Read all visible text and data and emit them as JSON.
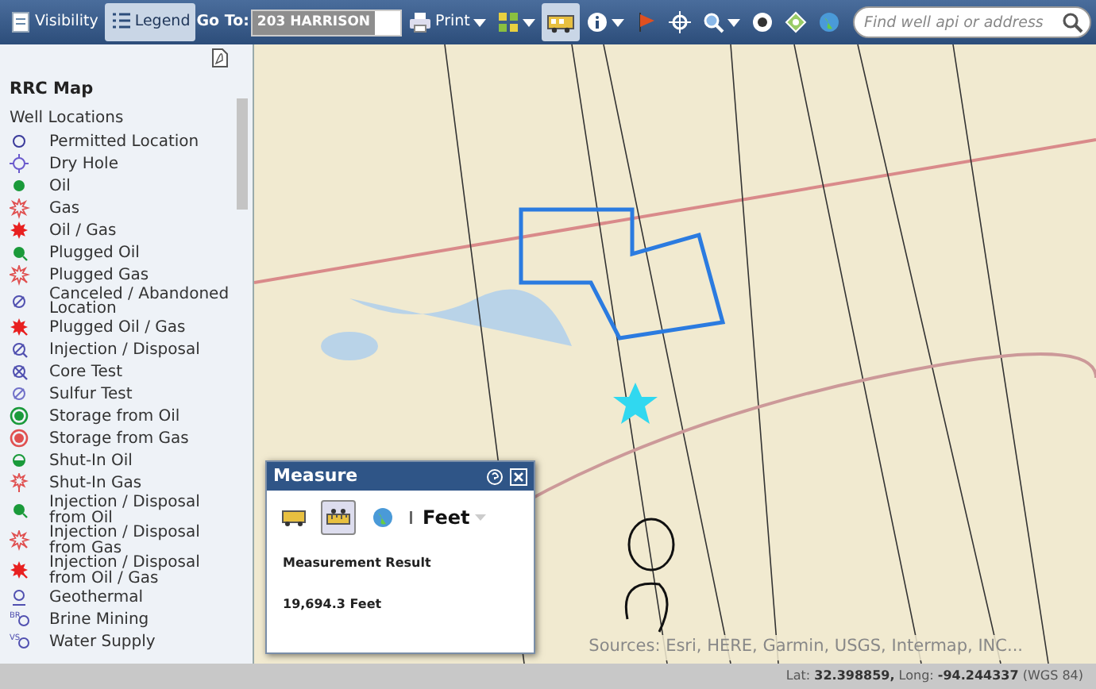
{
  "toolbar": {
    "tools": [
      {
        "kind": "button",
        "label": "Visibility",
        "selected": false
      },
      {
        "kind": "button",
        "label": "Legend",
        "selected": true
      },
      {
        "kind": "label",
        "label": "Go To:"
      },
      {
        "kind": "field",
        "value": "203 HARRISON"
      },
      {
        "kind": "menu",
        "label": "Print",
        "selected": false
      },
      {
        "kind": "menu",
        "selected": false
      },
      {
        "kind": "tool",
        "selected": true
      },
      {
        "kind": "menu",
        "selected": false
      },
      {
        "kind": "tool",
        "selected": false
      },
      {
        "kind": "tool",
        "selected": false
      },
      {
        "kind": "menu",
        "selected": false
      },
      {
        "kind": "tool",
        "selected": false
      },
      {
        "kind": "tool",
        "selected": false
      },
      {
        "kind": "tool",
        "selected": false
      }
    ],
    "search": {
      "placeholder": "Find well api or address"
    }
  },
  "sidebar": {
    "title": "RRC Map",
    "section": "Well Locations",
    "items": [
      {
        "label": "Permitted Location",
        "kind": "ring",
        "color": "#3a3a9a",
        "tailed": false
      },
      {
        "label": "Dry Hole",
        "kind": "target",
        "color": "#6a5acd",
        "tailed": false
      },
      {
        "label": "Oil",
        "kind": "dot",
        "color": "#1a9a3a",
        "tailed": false
      },
      {
        "label": "Gas",
        "kind": "star",
        "color": "#e05050",
        "tailed": false
      },
      {
        "label": "Oil / Gas",
        "kind": "burst",
        "color": "#e82020",
        "tailed": false
      },
      {
        "label": "Plugged Oil",
        "kind": "dot",
        "color": "#1a9a3a",
        "tailed": true
      },
      {
        "label": "Plugged Gas",
        "kind": "star",
        "color": "#e05050",
        "tailed": true
      },
      {
        "label": "Canceled / Abandoned Location",
        "kind": "slashed",
        "color": "#5050b0",
        "tailed": false
      },
      {
        "label": "Plugged Oil / Gas",
        "kind": "burst",
        "color": "#e82020",
        "tailed": true
      },
      {
        "label": "Injection / Disposal",
        "kind": "slashed",
        "color": "#5050b0",
        "tailed": true
      },
      {
        "label": "Core Test",
        "kind": "crossed",
        "color": "#5050b0",
        "tailed": true
      },
      {
        "label": "Sulfur Test",
        "kind": "slashed",
        "color": "#7070c8",
        "tailed": false
      },
      {
        "label": "Storage from Oil",
        "kind": "doublering",
        "color": "#1a9a3a",
        "tailed": false
      },
      {
        "label": "Storage from Gas",
        "kind": "doublering",
        "color": "#e05050",
        "tailed": false
      },
      {
        "label": "Shut-In Oil",
        "kind": "halfdot",
        "color": "#1a9a3a",
        "tailed": false
      },
      {
        "label": "Shut-In Gas",
        "kind": "stemstar",
        "color": "#e05050",
        "tailed": false
      },
      {
        "label": "Injection / Disposal from Oil",
        "kind": "dot",
        "color": "#1a9a3a",
        "tailed": true
      },
      {
        "label": "Injection / Disposal from Gas",
        "kind": "star",
        "color": "#e05050",
        "tailed": true
      },
      {
        "label": "Injection / Disposal from Oil / Gas",
        "kind": "burst",
        "color": "#e82020",
        "tailed": true
      },
      {
        "label": "Geothermal",
        "kind": "geothermal",
        "color": "#5050b0",
        "tailed": false
      },
      {
        "label": "Brine Mining",
        "kind": "lettered",
        "color": "#5050b0",
        "tailed": false,
        "letters": "BR"
      },
      {
        "label": "Water Supply",
        "kind": "lettered",
        "color": "#5050b0",
        "tailed": false,
        "letters": "VS"
      }
    ]
  },
  "map": {
    "kind": "picture",
    "attribution": "Sources: Esri, HERE, Garmin, USGS, Intermap, INC..."
  },
  "measure_panel": {
    "title": "Measure",
    "tools": [
      {
        "selected": false
      },
      {
        "selected": true
      },
      {
        "selected": false
      }
    ],
    "unit": "Feet",
    "result_label": "Measurement Result",
    "result": "19,694.3 Feet"
  },
  "status_bar": {
    "coordinates": "Lat: **32.398859,** Long: **-94.244337** (WGS 84)"
  }
}
